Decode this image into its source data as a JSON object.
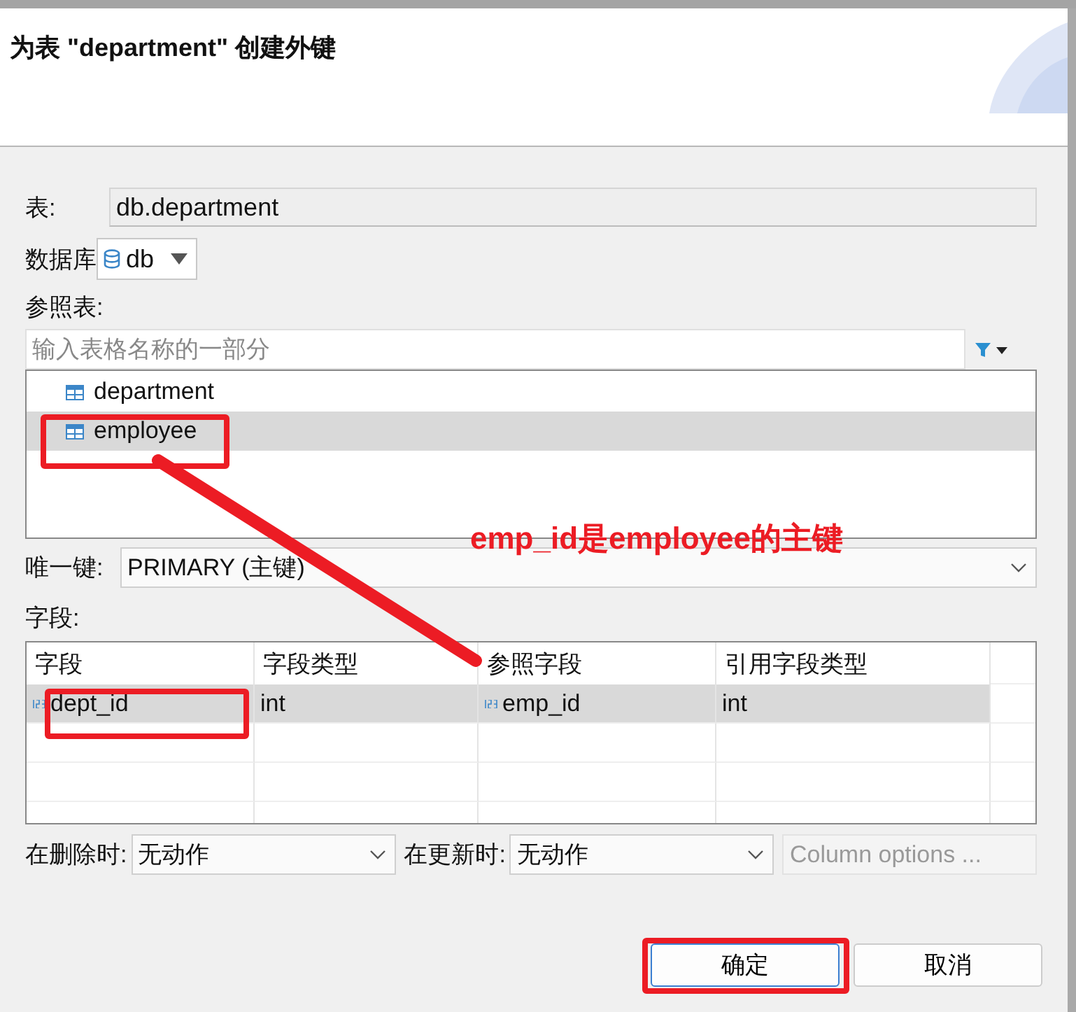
{
  "window": {
    "title": "为表 \"department\" 创建外键"
  },
  "table_field": {
    "label": "表:",
    "value": "db.department"
  },
  "database": {
    "label": "数据库",
    "value": "db"
  },
  "reference_table": {
    "label": "参照表:",
    "placeholder": "输入表格名称的一部分",
    "items": [
      {
        "name": "department",
        "selected": false
      },
      {
        "name": "employee",
        "selected": true
      }
    ]
  },
  "unique_key": {
    "label": "唯一键:",
    "value": "PRIMARY (主键)"
  },
  "fields": {
    "label": "字段:",
    "columns": [
      "字段",
      "字段类型",
      "参照字段",
      "引用字段类型"
    ],
    "rows": [
      {
        "selected": true,
        "cells": [
          "dept_id",
          "int",
          "emp_id",
          "int"
        ]
      }
    ]
  },
  "on_delete": {
    "label": "在删除时:",
    "value": "无动作"
  },
  "on_update": {
    "label": "在更新时:",
    "value": "无动作"
  },
  "column_options": {
    "label": "Column options ...",
    "disabled": true
  },
  "buttons": [
    {
      "label": "确定",
      "default": true
    },
    {
      "label": "取消",
      "default": false
    }
  ],
  "annotation": {
    "text": "emp_id是employee的主键"
  }
}
